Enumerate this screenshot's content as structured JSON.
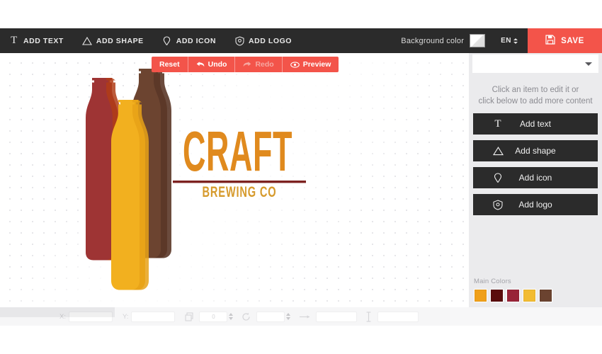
{
  "header": {
    "tools": [
      {
        "label": "ADD TEXT",
        "icon": "text-icon"
      },
      {
        "label": "ADD SHAPE",
        "icon": "shape-icon"
      },
      {
        "label": "ADD ICON",
        "icon": "pin-icon"
      },
      {
        "label": "ADD LOGO",
        "icon": "shield-icon"
      }
    ],
    "background_color_label": "Background color",
    "background_color_value": "#ffffff",
    "language": "EN",
    "save_label": "SAVE",
    "bar_color": "#2b2b2b",
    "accent_color": "#f3544a"
  },
  "history": {
    "reset": "Reset",
    "undo": "Undo",
    "redo": "Redo",
    "preview": "Preview"
  },
  "canvas": {
    "logo": {
      "title": "CRAFT",
      "subtitle": "BREWING CO",
      "title_color": "#e08a1e",
      "subtitle_color": "#d69a2c",
      "rule_color": "#7d2220",
      "bottles": [
        {
          "name": "bottle-left",
          "fill": "#9e3434",
          "shade": "#b03d17"
        },
        {
          "name": "bottle-center",
          "fill": "#f2b01f",
          "shade": "#e8a218"
        },
        {
          "name": "bottle-right",
          "fill": "#6c4430",
          "shade": "#5b3728"
        }
      ]
    }
  },
  "sidebar": {
    "select_value": "",
    "hint_line1": "Click an item to edit it or",
    "hint_line2": "click below to add more content",
    "actions": [
      {
        "label": "Add text",
        "icon": "text-icon"
      },
      {
        "label": "Add shape",
        "icon": "shape-icon"
      },
      {
        "label": "Add icon",
        "icon": "pin-icon"
      },
      {
        "label": "Add logo",
        "icon": "shield-icon"
      }
    ],
    "colors_label": "Main Colors",
    "colors": [
      "#f0a019",
      "#5a0c0c",
      "#982438",
      "#f2bc32",
      "#6b4330"
    ]
  },
  "bottombar": {
    "x_label": "X:",
    "x_value": "",
    "y_label": "Y:",
    "y_value": "",
    "angle_value": "0",
    "scale_value": "",
    "width_value": "",
    "height_value": ""
  }
}
